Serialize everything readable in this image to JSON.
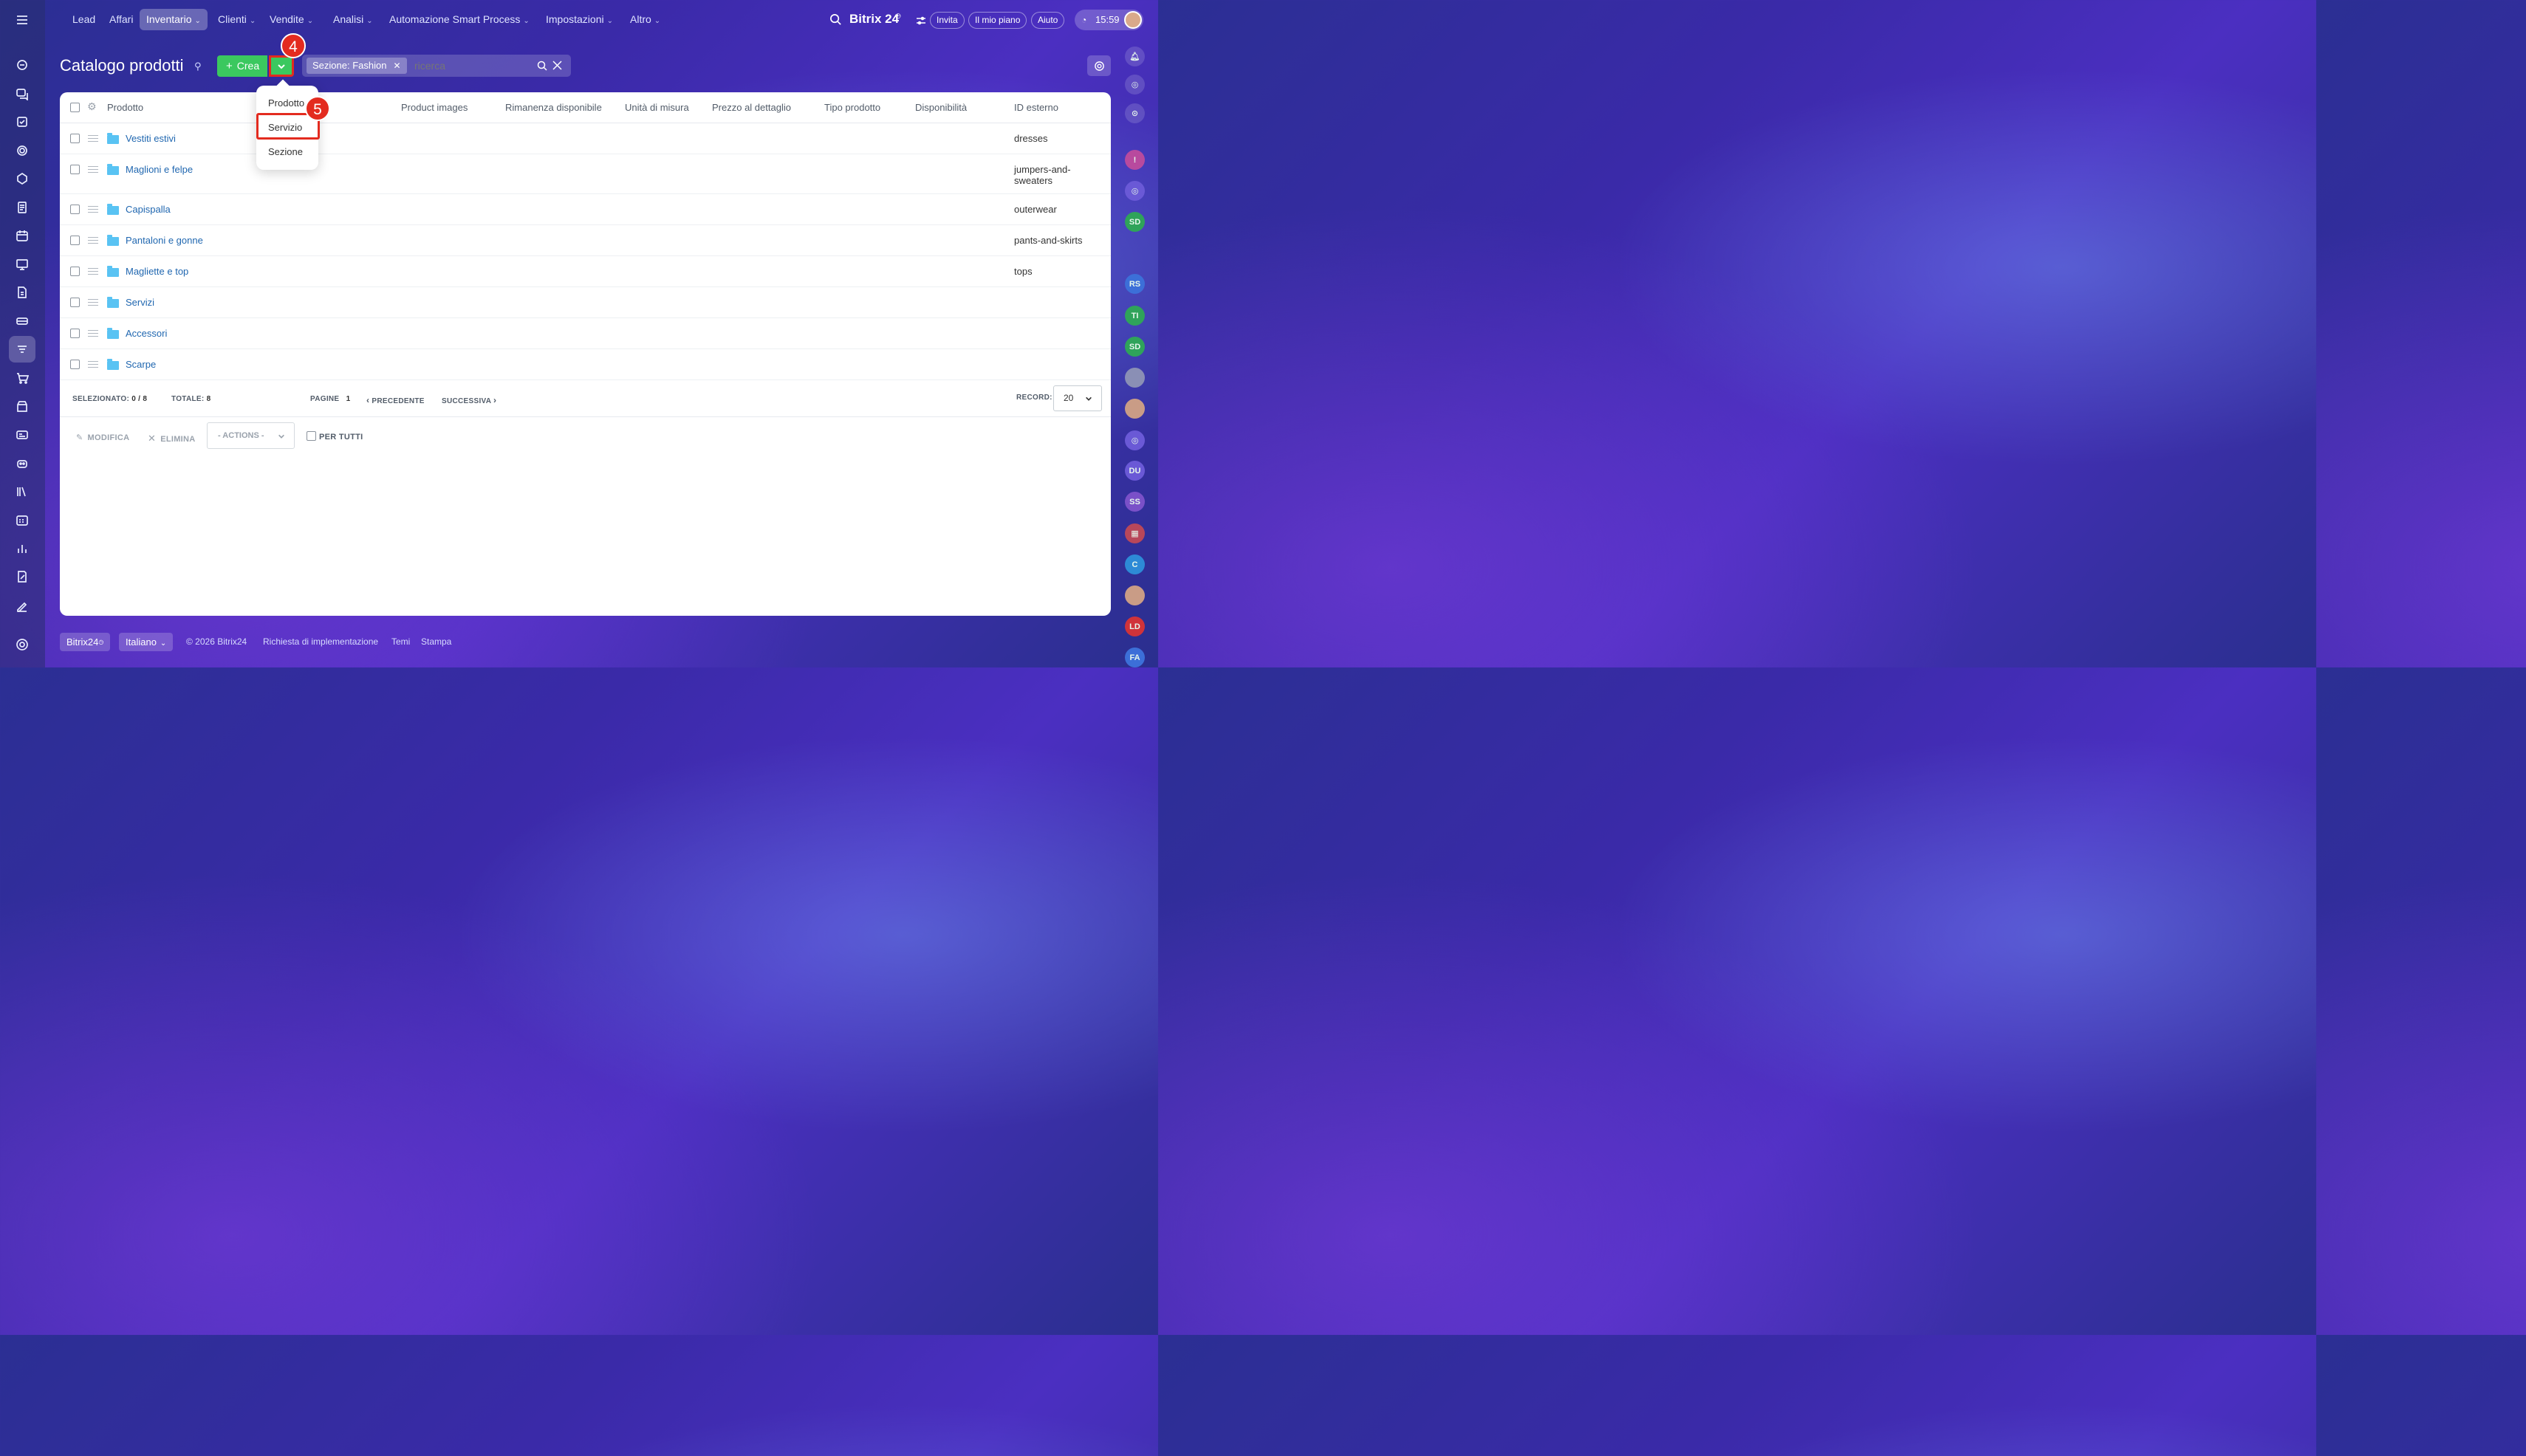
{
  "topnav": {
    "items": [
      {
        "label": "Lead",
        "chevron": false
      },
      {
        "label": "Affari",
        "chevron": false
      },
      {
        "label": "Inventario",
        "chevron": true
      },
      {
        "label": "Clienti",
        "chevron": true
      },
      {
        "label": "Vendite",
        "chevron": true
      },
      {
        "label": "Analisi",
        "chevron": true
      },
      {
        "label": "Automazione Smart Process",
        "chevron": true
      },
      {
        "label": "Impostazioni",
        "chevron": true
      },
      {
        "label": "Altro",
        "chevron": true
      }
    ],
    "brand": "Bitrix 24",
    "invite": "Invita",
    "plan": "Il mio piano",
    "help": "Aiuto",
    "time": "15:59"
  },
  "header": {
    "title": "Catalogo prodotti",
    "create_label": "Crea",
    "filter_chip": "Sezione: Fashion",
    "search_placeholder": "ricerca"
  },
  "dropdown": {
    "items": [
      "Prodotto",
      "Servizio",
      "Sezione"
    ]
  },
  "steps": {
    "a": "4",
    "b": "5"
  },
  "table": {
    "columns": [
      "Prodotto",
      "Product images",
      "Rimanenza disponibile",
      "Unità di misura",
      "Prezzo al dettaglio",
      "Tipo prodotto",
      "Disponibilità",
      "ID esterno"
    ],
    "rows": [
      {
        "name": "Vestiti estivi",
        "ext_id": "dresses"
      },
      {
        "name": "Maglioni e felpe",
        "ext_id": "jumpers-and-\nsweaters"
      },
      {
        "name": "Capispalla",
        "ext_id": "outerwear"
      },
      {
        "name": "Pantaloni e gonne",
        "ext_id": "pants-and-skirts"
      },
      {
        "name": "Magliette e top",
        "ext_id": "tops"
      },
      {
        "name": "Servizi",
        "ext_id": ""
      },
      {
        "name": "Accessori",
        "ext_id": ""
      },
      {
        "name": "Scarpe",
        "ext_id": ""
      }
    ]
  },
  "pager": {
    "selected_label": "SELEZIONATO:",
    "selected_value": "0 / 8",
    "total_label": "TOTALE:",
    "total_value": "8",
    "pages_label": "PAGINE",
    "page_value": "1",
    "prev": "PRECEDENTE",
    "next": "SUCCESSIVA",
    "records_label": "RECORD:",
    "records_value": "20"
  },
  "actions": {
    "edit": "MODIFICA",
    "delete": "ELIMINA",
    "actions_select": "- ACTIONS -",
    "for_all": "PER TUTTI"
  },
  "rrail": {
    "bubbles": [
      {
        "text": "SD",
        "color": "#2fa35a"
      },
      {
        "text": "RS",
        "color": "#3c6fd8"
      },
      {
        "text": "TI",
        "color": "#2fa35a"
      },
      {
        "text": "SD",
        "color": "#2fa35a"
      },
      {
        "text": "DU",
        "color": "#6a59d6"
      },
      {
        "text": "SS",
        "color": "#7a50c8"
      },
      {
        "text": "C",
        "color": "#2d8ad6"
      },
      {
        "text": "LD",
        "color": "#d0333a"
      },
      {
        "text": "FA",
        "color": "#3c6fd8"
      }
    ]
  },
  "footer": {
    "brand": "Bitrix24",
    "language": "Italiano",
    "copyright": "© 2026 Bitrix24",
    "links": [
      "Richiesta di implementazione",
      "Temi",
      "Stampa"
    ]
  },
  "colors": {
    "accent_green": "#3bc85f",
    "highlight_red": "#e32b1f",
    "link_blue": "#2067b0"
  }
}
